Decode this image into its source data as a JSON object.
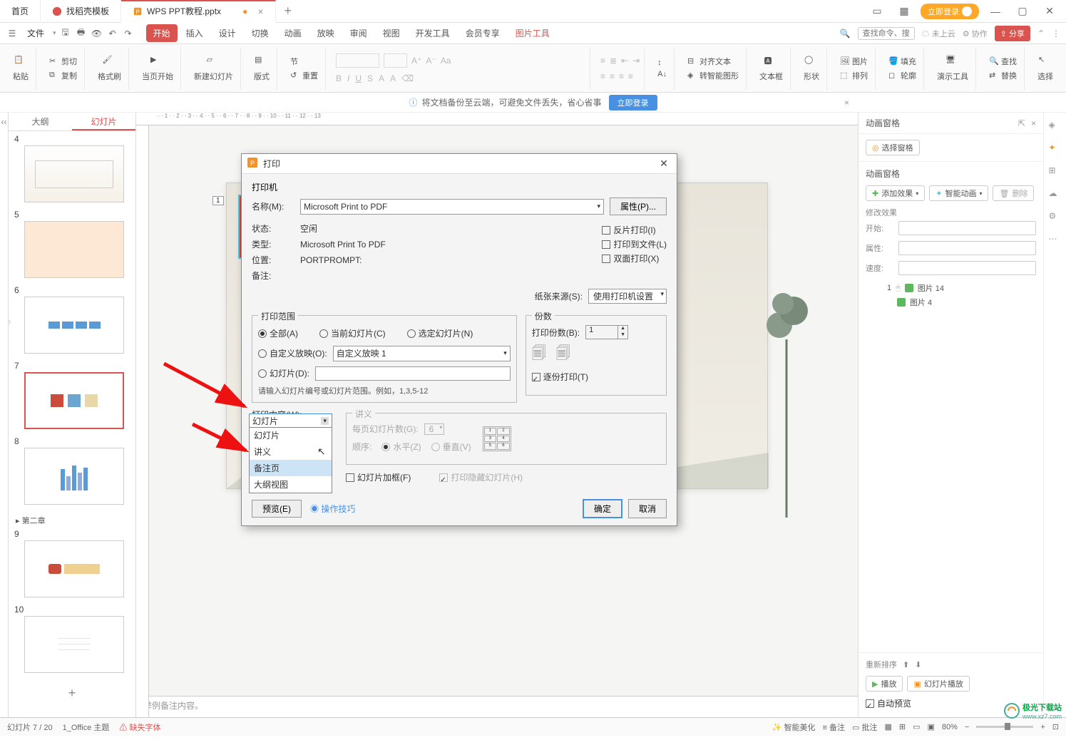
{
  "titlebar": {
    "tabs": [
      {
        "label": "首页",
        "icon": "home"
      },
      {
        "label": "找稻壳模板",
        "icon": "docer"
      },
      {
        "label": "WPS PPT教程.pptx",
        "icon": "ppt",
        "active": true,
        "dirty": true
      }
    ],
    "login": "立即登录"
  },
  "menubar": {
    "file": "文件",
    "tabs": [
      "开始",
      "插入",
      "设计",
      "切换",
      "动画",
      "放映",
      "审阅",
      "视图",
      "开发工具",
      "会员专享",
      "图片工具"
    ],
    "active_tab": "开始",
    "search_placeholder": "查找命令、搜索模板",
    "not_cloud": "未上云",
    "coop": "协作",
    "share": "分享"
  },
  "toolbar": {
    "paste": "粘贴",
    "cut": "剪切",
    "copy": "复制",
    "format_painter": "格式刷",
    "from_current": "当页开始",
    "new_slide": "新建幻灯片",
    "layout": "版式",
    "section": "节",
    "reset": "重置",
    "align_text": "对齐文本",
    "to_smart": "转智能图形",
    "textbox": "文本框",
    "shape": "形状",
    "arrange": "排列",
    "image": "图片",
    "fill": "填充",
    "outline": "轮廓",
    "present": "演示工具",
    "find": "查找",
    "replace": "替换",
    "select": "选择"
  },
  "banner": {
    "msg": "将文档备份至云端，可避免文件丢失，省心省事",
    "btn": "立即登录"
  },
  "thumbs": {
    "tab_outline": "大纲",
    "tab_slides": "幻灯片",
    "section": "第二章",
    "slides": [
      {
        "n": "4"
      },
      {
        "n": "5"
      },
      {
        "n": "6"
      },
      {
        "n": "7",
        "selected": true
      },
      {
        "n": "8"
      },
      {
        "n": "9"
      },
      {
        "n": "10"
      }
    ]
  },
  "slide": {
    "tag": "1"
  },
  "notes": {
    "placeholder": "举例备注内容。"
  },
  "panel": {
    "title": "动画窗格",
    "select_pane": "选择窗格",
    "pane_title": "动画窗格",
    "add_effect": "添加效果",
    "smart_anim": "智能动画",
    "delete": "删除",
    "modify": "修改效果",
    "start": "开始:",
    "property": "属性:",
    "speed": "速度:",
    "tree": [
      {
        "idx": "1",
        "label": "图片 14"
      },
      {
        "idx": "",
        "label": "图片 4"
      }
    ],
    "reorder": "重新排序",
    "play": "播放",
    "slideshow": "幻灯片播放",
    "autopreview": "自动预览"
  },
  "status": {
    "slide_pos": "幻灯片 7 / 20",
    "theme": "1_Office 主题",
    "missing_font": "缺失字体",
    "ai_beautify": "智能美化",
    "notes": "备注",
    "comments": "批注",
    "zoom": "80%"
  },
  "dialog": {
    "title": "打印",
    "printer_section": "打印机",
    "name_label": "名称(M):",
    "name_value": "Microsoft Print to PDF",
    "props_btn": "属性(P)...",
    "status_label": "状态:",
    "status_value": "空闲",
    "type_label": "类型:",
    "type_value": "Microsoft Print To PDF",
    "where_label": "位置:",
    "where_value": "PORTPROMPT:",
    "comment_label": "备注:",
    "reverse": "反片打印(I)",
    "to_file": "打印到文件(L)",
    "duplex": "双面打印(X)",
    "paper_source_label": "纸张来源(S):",
    "paper_source_value": "使用打印机设置",
    "range_section": "打印范围",
    "all": "全部(A)",
    "current": "当前幻灯片(C)",
    "selected": "选定幻灯片(N)",
    "custom_show": "自定义放映(O):",
    "custom_show_value": "自定义放映 1",
    "slides_opt": "幻灯片(D):",
    "range_hint": "请输入幻灯片编号或幻灯片范围。例如，1,3,5-12",
    "copies_section": "份数",
    "copies_label": "打印份数(B):",
    "copies_value": "1",
    "collate": "逐份打印(T)",
    "content_label": "打印内容(W):",
    "content_value": "幻灯片",
    "content_options": [
      "幻灯片",
      "讲义",
      "备注页",
      "大纲视图"
    ],
    "handout_section": "讲义",
    "per_page_label": "每页幻灯片数(G):",
    "per_page_value": "6",
    "order_label": "顺序:",
    "horizontal": "水平(Z)",
    "vertical": "垂直(V)",
    "frame": "幻灯片加框(F)",
    "print_hidden": "打印隐藏幻灯片(H)",
    "preview": "预览(E)",
    "tips": "操作技巧",
    "ok": "确定",
    "cancel": "取消"
  },
  "watermark": {
    "brand": "极光下载站",
    "url": "www.xz7.com"
  }
}
